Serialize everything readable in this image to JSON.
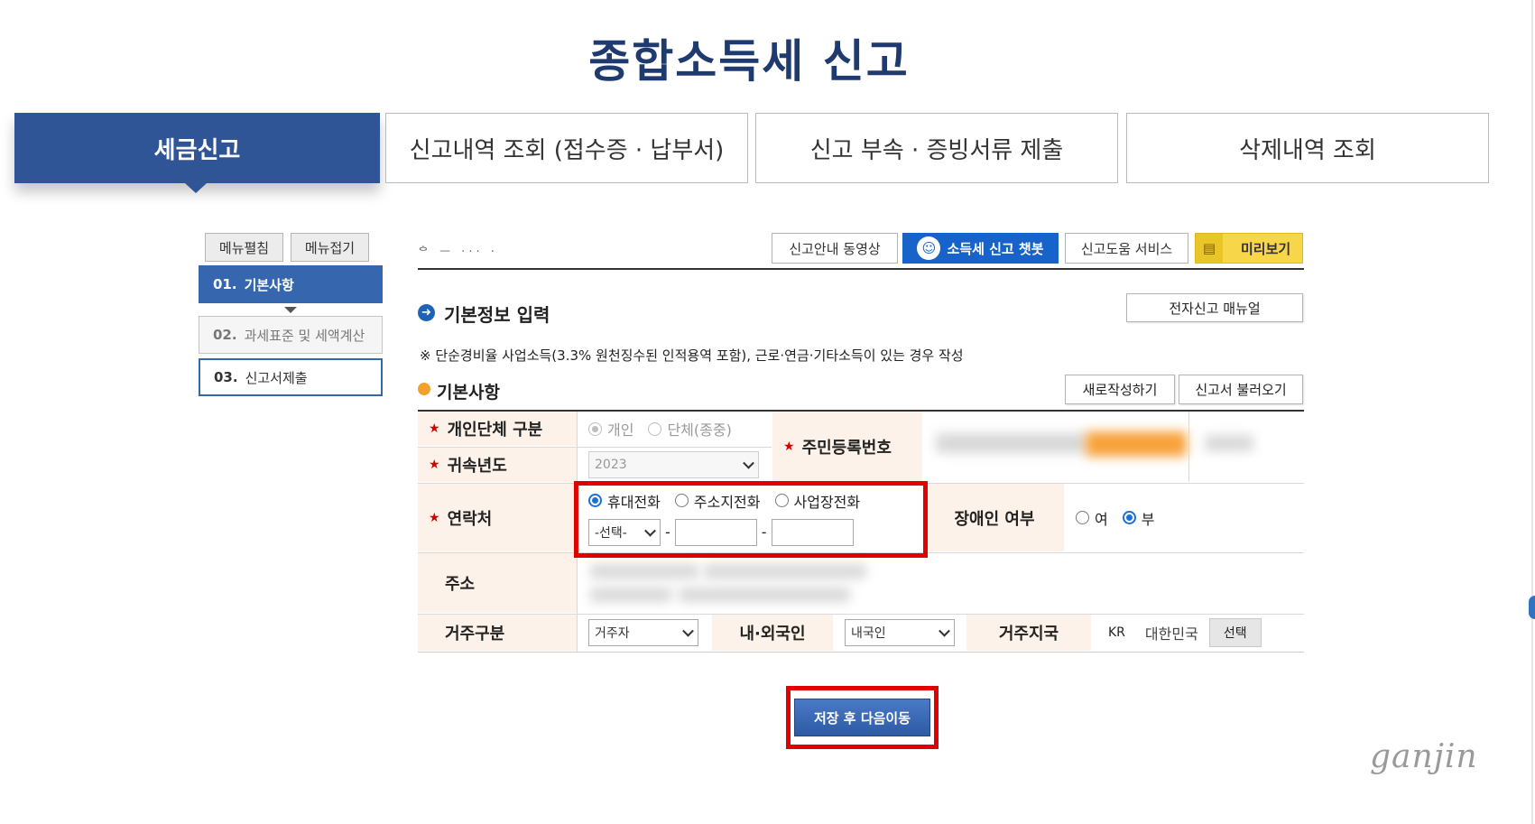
{
  "page": {
    "title": "종합소득세 신고"
  },
  "tabs": [
    {
      "label": "세금신고",
      "active": true
    },
    {
      "label": "신고내역 조회 (접수증 · 납부서)"
    },
    {
      "label": "신고 부속 · 증빙서류 제출"
    },
    {
      "label": "삭제내역 조회"
    }
  ],
  "sidebar": {
    "expand_label": "메뉴펼침",
    "collapse_label": "메뉴접기",
    "steps": [
      {
        "num": "01.",
        "label": "기본사항"
      },
      {
        "num": "02.",
        "label": "과세표준 및 세액계산"
      },
      {
        "num": "03.",
        "label": "신고서제출"
      }
    ]
  },
  "toolbar": {
    "faint_text": "ᅌ ᅳ ··· ·",
    "guide_video": "신고안내 동영상",
    "chatbot": "소득세 신고 챗봇",
    "help_service": "신고도움 서비스",
    "preview": "미리보기"
  },
  "section": {
    "title": "기본정보 입력",
    "manual_button": "전자신고 매뉴얼",
    "notice": "※ 단순경비율 사업소득(3.3% 원천징수된 인적용역 포함), 근로·연금·기타소득이 있는 경우 작성",
    "sub_title": "기본사항",
    "new_button": "새로작성하기",
    "load_button": "신고서 불러오기"
  },
  "form": {
    "type_label": "개인단체 구분",
    "type_options": [
      "개인",
      "단체(종중)"
    ],
    "year_label": "귀속년도",
    "year_value": "2023",
    "rrn_label": "주민등록번호",
    "contact_label": "연락처",
    "contact_options": [
      "휴대전화",
      "주소지전화",
      "사업장전화"
    ],
    "contact_select": "-선택-",
    "dash": "-",
    "disabled_label": "장애인 여부",
    "disabled_options": [
      "여",
      "부"
    ],
    "address_label": "주소",
    "residence_label": "거주구분",
    "residence_value": "거주자",
    "nationality_label": "내·외국인",
    "nationality_value": "내국인",
    "country_label": "거주지국",
    "country_code": "KR",
    "country_name": "대한민국",
    "country_select_button": "선택"
  },
  "actions": {
    "save_next": "저장 후 다음이동"
  },
  "watermark": "ganjin",
  "colors": {
    "primary": "#2f5597",
    "highlight": "#e00000",
    "label_bg": "#fdf2e9",
    "preview_yellow": "#f7d64a"
  }
}
